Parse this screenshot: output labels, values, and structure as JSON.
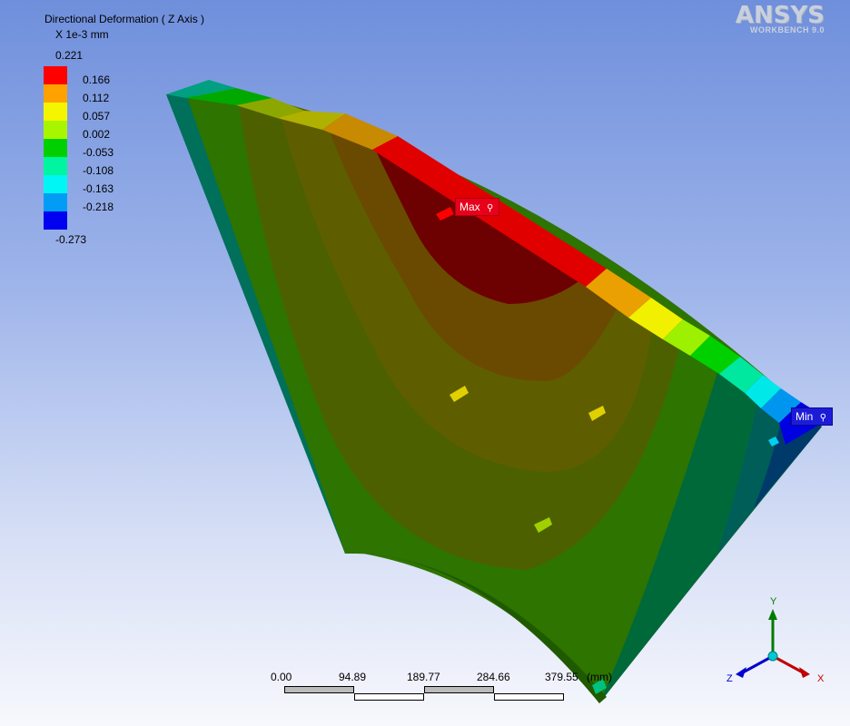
{
  "legend": {
    "title": "Directional Deformation ( Z Axis )",
    "units": "X 1e-3 mm",
    "max_value": "0.221",
    "min_value": "-0.273",
    "bands": [
      {
        "label": "0.166",
        "color": "#ff0000"
      },
      {
        "label": "0.112",
        "color": "#ffa200"
      },
      {
        "label": "0.057",
        "color": "#f5f500"
      },
      {
        "label": "0.002",
        "color": "#a8f500"
      },
      {
        "label": "-0.053",
        "color": "#00d000"
      },
      {
        "label": "-0.108",
        "color": "#00f5a0"
      },
      {
        "label": "-0.163",
        "color": "#00f5f5"
      },
      {
        "label": "-0.218",
        "color": "#009cf5"
      },
      {
        "label": "",
        "color": "#0000f0"
      }
    ]
  },
  "logo": {
    "main": "ANSYS",
    "sub": "WORKBENCH 9.0"
  },
  "probes": {
    "max_label": "Max",
    "min_label": "Min"
  },
  "scale_bar": {
    "ticks": [
      "0.00",
      "94.89",
      "189.77",
      "284.66",
      "379.55"
    ],
    "unit": "(mm)"
  },
  "triad": {
    "x": "X",
    "y": "Y",
    "z": "Z",
    "x_color": "#c00000",
    "y_color": "#007a00",
    "z_color": "#0000d0"
  },
  "contour_colors": {
    "dark_red": "#6e0000",
    "brown": "#6e4a00",
    "olive": "#5a5a00",
    "dark_olive": "#4a6400",
    "green": "#2f7a00",
    "dark_green": "#006a2a",
    "teal": "#005e58",
    "navy": "#003060",
    "deep_blue": "#000060"
  }
}
